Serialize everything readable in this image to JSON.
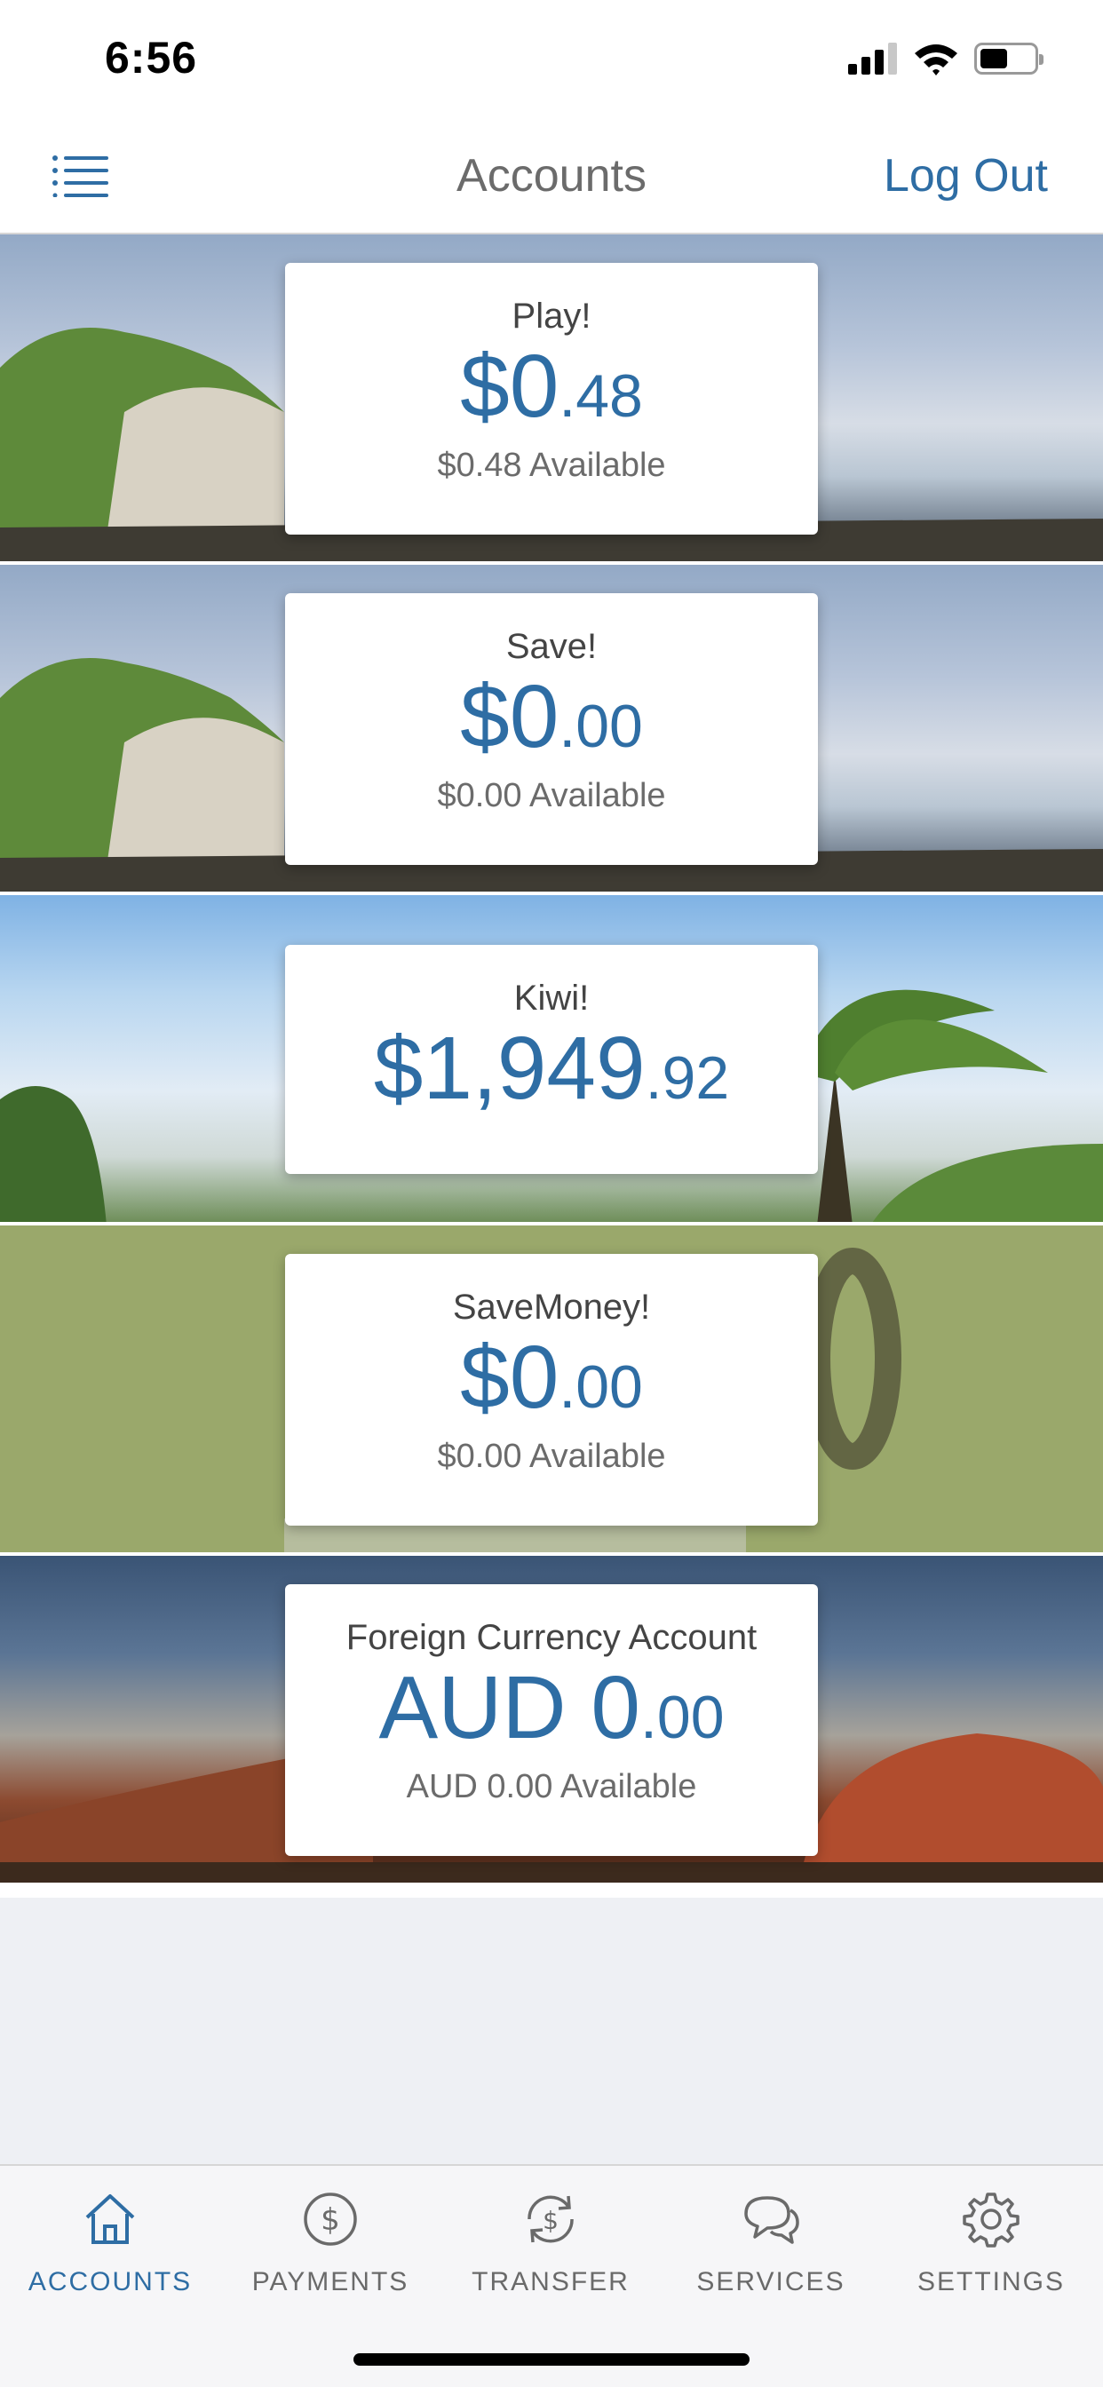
{
  "status_bar": {
    "time": "6:56"
  },
  "nav": {
    "title": "Accounts",
    "logout_label": "Log Out"
  },
  "accounts": [
    {
      "name": "Play!",
      "balance_major": "$0",
      "balance_minor": ".48",
      "available": "$0.48 Available"
    },
    {
      "name": "Save!",
      "balance_major": "$0",
      "balance_minor": ".00",
      "available": "$0.00 Available"
    },
    {
      "name": "Kiwi!",
      "balance_major": "$1,949",
      "balance_minor": ".92",
      "available": ""
    },
    {
      "name": "SaveMoney!",
      "balance_major": "$0",
      "balance_minor": ".00",
      "available": "$0.00 Available"
    },
    {
      "name": "Foreign Currency Account",
      "balance_major": "AUD 0",
      "balance_minor": ".00",
      "available": "AUD 0.00 Available"
    }
  ],
  "tabs": [
    {
      "label": "ACCOUNTS",
      "icon": "home-icon",
      "active": true
    },
    {
      "label": "PAYMENTS",
      "icon": "dollar-circle-icon",
      "active": false
    },
    {
      "label": "TRANSFER",
      "icon": "transfer-icon",
      "active": false
    },
    {
      "label": "SERVICES",
      "icon": "chat-icon",
      "active": false
    },
    {
      "label": "SETTINGS",
      "icon": "gear-icon",
      "active": false
    }
  ],
  "colors": {
    "accent": "#2e6da4",
    "tab_inactive": "#6a6a6a",
    "background": "#eef0f4"
  }
}
